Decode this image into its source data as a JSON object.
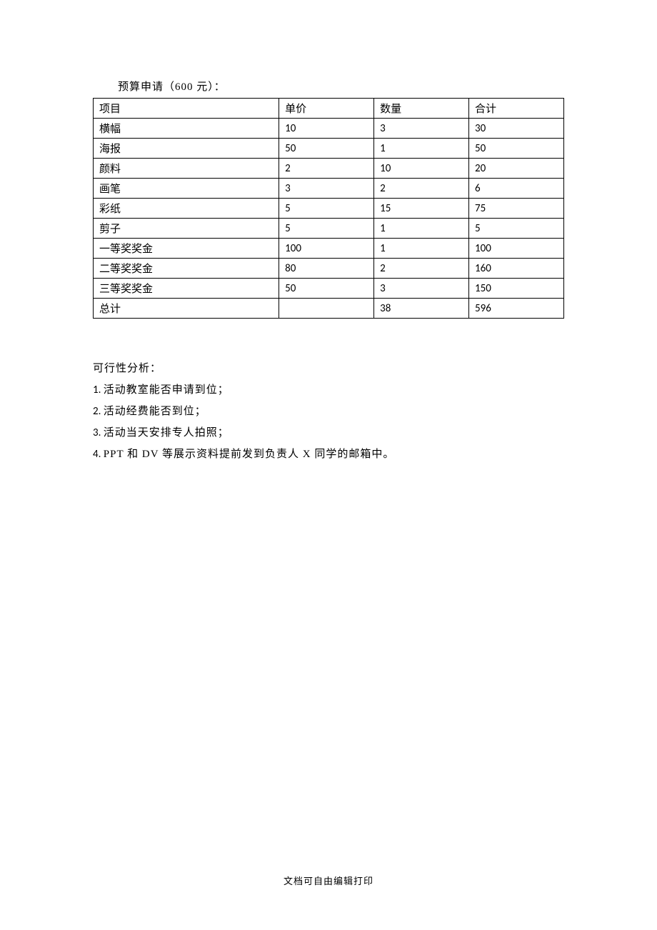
{
  "budget": {
    "title": "预算申请（600 元）：",
    "headers": [
      "项目",
      "单价",
      "数量",
      "合计"
    ],
    "rows": [
      {
        "item": "横幅",
        "unit_price": "10",
        "quantity": "3",
        "total": "30"
      },
      {
        "item": "海报",
        "unit_price": "50",
        "quantity": "1",
        "total": "50"
      },
      {
        "item": "颜料",
        "unit_price": "2",
        "quantity": "10",
        "total": "20"
      },
      {
        "item": "画笔",
        "unit_price": "3",
        "quantity": "2",
        "total": "6"
      },
      {
        "item": "彩纸",
        "unit_price": "5",
        "quantity": "15",
        "total": "75"
      },
      {
        "item": "剪子",
        "unit_price": "5",
        "quantity": "1",
        "total": "5"
      },
      {
        "item": "一等奖奖金",
        "unit_price": "100",
        "quantity": "1",
        "total": "100"
      },
      {
        "item": "二等奖奖金",
        "unit_price": "80",
        "quantity": "2",
        "total": "160"
      },
      {
        "item": "三等奖奖金",
        "unit_price": "50",
        "quantity": "3",
        "total": "150"
      }
    ],
    "summary": {
      "item": "总计",
      "unit_price": "",
      "quantity": "38",
      "total": "596"
    }
  },
  "analysis": {
    "title": "可行性分析：",
    "items": [
      {
        "num": "1. ",
        "text": "活动教室能否申请到位；"
      },
      {
        "num": "2. ",
        "text": "活动经费能否到位；"
      },
      {
        "num": "3. ",
        "text": "活动当天安排专人拍照；"
      },
      {
        "num": "4. ",
        "text": "PPT 和 DV 等展示资料提前发到负责人 X 同学的邮箱中。"
      }
    ]
  },
  "footer": "文档可自由编辑打印",
  "chart_data": {
    "type": "table",
    "title": "预算申请（600 元）",
    "headers": [
      "项目",
      "单价",
      "数量",
      "合计"
    ],
    "rows": [
      [
        "横幅",
        10,
        3,
        30
      ],
      [
        "海报",
        50,
        1,
        50
      ],
      [
        "颜料",
        2,
        10,
        20
      ],
      [
        "画笔",
        3,
        2,
        6
      ],
      [
        "彩纸",
        5,
        15,
        75
      ],
      [
        "剪子",
        5,
        1,
        5
      ],
      [
        "一等奖奖金",
        100,
        1,
        100
      ],
      [
        "二等奖奖金",
        80,
        2,
        160
      ],
      [
        "三等奖奖金",
        50,
        3,
        150
      ],
      [
        "总计",
        null,
        38,
        596
      ]
    ]
  }
}
